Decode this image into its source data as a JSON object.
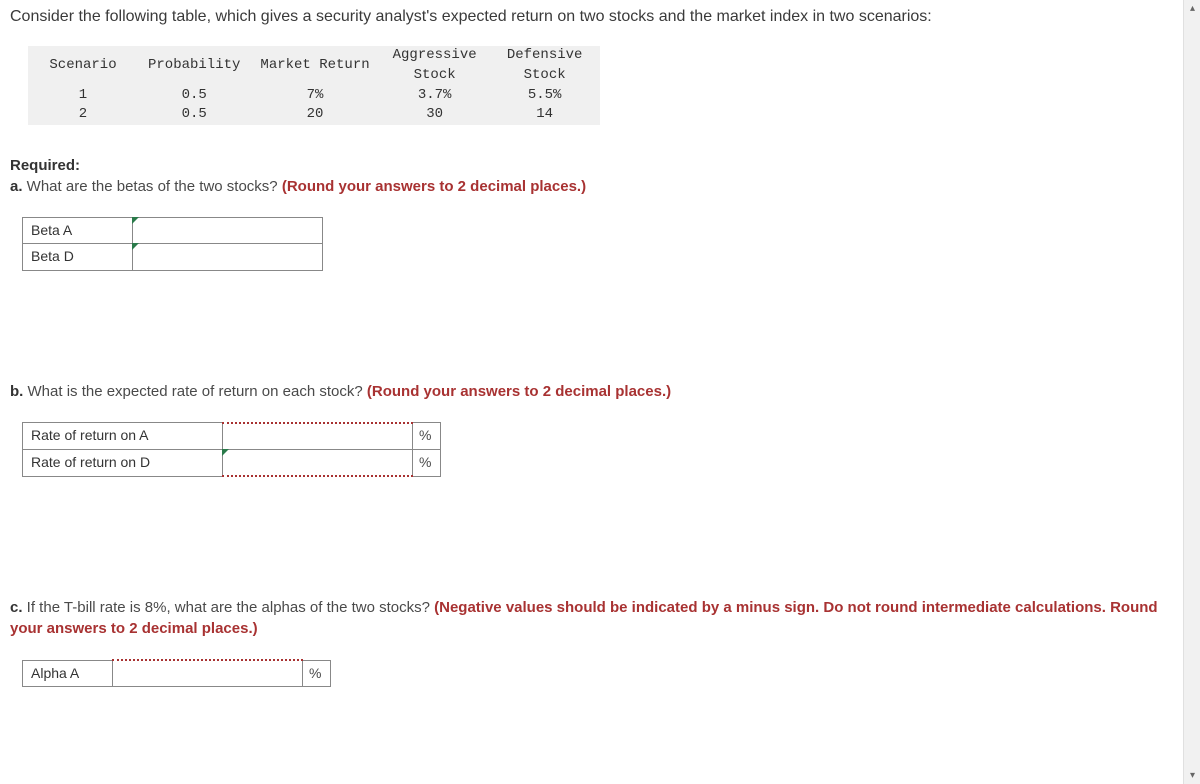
{
  "intro": "Consider the following table, which gives a security analyst's expected return on two stocks and the market index in two scenarios:",
  "table": {
    "headers": [
      "Scenario",
      "Probability",
      "Market Return",
      "Aggressive Stock",
      "Defensive Stock"
    ],
    "rows": [
      [
        "1",
        "0.5",
        "7%",
        "3.7%",
        "5.5%"
      ],
      [
        "2",
        "0.5",
        "20",
        "30",
        "14"
      ]
    ]
  },
  "required_label": "Required:",
  "qa": {
    "prefix": "a.",
    "text": " What are the betas of the two stocks? ",
    "hint": "(Round your answers to 2 decimal places.)"
  },
  "table_a": {
    "rows": [
      {
        "label": "Beta A"
      },
      {
        "label": "Beta D"
      }
    ]
  },
  "qb": {
    "prefix": "b.",
    "text": " What is the expected rate of return on each stock? ",
    "hint": "(Round your answers to 2 decimal places.)"
  },
  "table_b": {
    "rows": [
      {
        "label": "Rate of return on A",
        "unit": "%"
      },
      {
        "label": "Rate of return on D",
        "unit": "%"
      }
    ]
  },
  "qc": {
    "prefix": "c.",
    "text": " If the T-bill rate is 8%, what are the alphas of the two stocks? ",
    "hint": "(Negative values should be indicated by a minus sign. Do not round intermediate calculations. Round your answers to 2 decimal places.)"
  },
  "table_c": {
    "rows": [
      {
        "label": "Alpha A",
        "unit": "%"
      }
    ]
  }
}
